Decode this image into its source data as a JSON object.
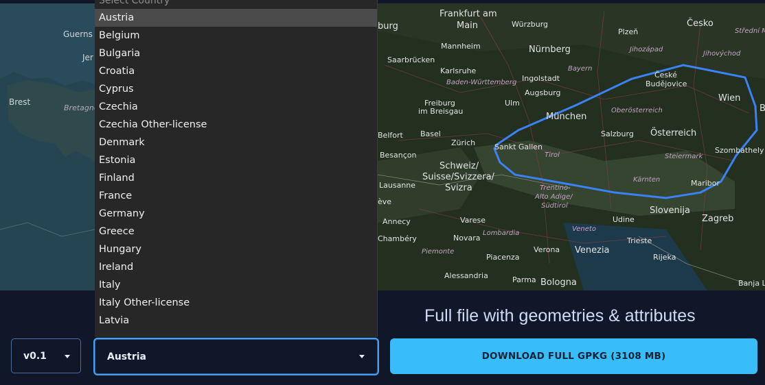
{
  "map_left": {
    "labels": [
      "Guerns",
      "Jer",
      "Brest",
      "Bretagne"
    ]
  },
  "map_right": {
    "labels": {
      "frankfurt": "Frankfurt am",
      "main": "Main",
      "wurzburg": "Würzburg",
      "plzen": "Plzeň",
      "cesko": "Česko",
      "stredni": "Střední M",
      "burg": "burg",
      "mannheim": "Mannheim",
      "nurnberg": "Nürnberg",
      "jihozapad": "Jihozápad",
      "jihovychod": "Jihovýchod",
      "saarbrucken": "Saarbrücken",
      "karlsruhe": "Karlsruhe",
      "bayern": "Bayern",
      "ceske": "České",
      "budejovice": "Budějovice",
      "bw": "Baden-Württemberg",
      "ingolstadt": "Ingolstadt",
      "augsburg": "Augsburg",
      "freiburg": "Freiburg",
      "breisgau": "im Breisgau",
      "ulm": "Ulm",
      "munchen": "München",
      "oberosterreich": "Oberösterreich",
      "wien": "Wien",
      "belfort": "Belfort",
      "basel": "Basel",
      "zurich": "Zürich",
      "salzburg": "Salzburg",
      "osterreich": "Österreich",
      "besancon": "Besançon",
      "stgallen": "Sankt Gallen",
      "tirol": "Tirol",
      "steiermark": "Steiermark",
      "szombathely": "Szombathely",
      "schweiz": "Schweiz/",
      "suisse": "Suisse/Svizzera/",
      "svizra": "Svizra",
      "lausanne": "Lausanne",
      "trentino": "Trentino-",
      "altoadige": "Alto Adige/",
      "sudtirol": "Südtirol",
      "karnten": "Kärnten",
      "maribor": "Maribor",
      "eve": "ève",
      "slovenija": "Slovenija",
      "annecy": "Annecy",
      "varese": "Varese",
      "udine": "Udine",
      "zagreb": "Zagreb",
      "chambery": "Chambéry",
      "lombardia": "Lombardia",
      "novara": "Novara",
      "veneto": "Veneto",
      "trieste": "Trieste",
      "piemonte": "Piemonte",
      "verona": "Verona",
      "venezia": "Venezia",
      "rijeka": "Rijeka",
      "piacenza": "Piacenza",
      "alessandria": "Alessandria",
      "parma": "Parma",
      "bologna": "Bologna",
      "banjal": "Banja L",
      "b": "B"
    }
  },
  "dropdown": {
    "placeholder": "Select Country",
    "options": [
      "Austria",
      "Belgium",
      "Bulgaria",
      "Croatia",
      "Cyprus",
      "Czechia",
      "Czechia Other-license",
      "Denmark",
      "Estonia",
      "Finland",
      "France",
      "Germany",
      "Greece",
      "Hungary",
      "Ireland",
      "Italy",
      "Italy Other-license",
      "Latvia"
    ],
    "selected_index": 0
  },
  "heading": "Full file with geometries & attributes",
  "version_select": {
    "value": "v0.1"
  },
  "country_select": {
    "value": "Austria"
  },
  "download_button": {
    "label": "DOWNLOAD FULL GPKG (3108 MB)"
  },
  "colors": {
    "background": "#0f1729",
    "accent": "#38bdf8",
    "boundary": "#3b82f6",
    "focus_border": "#4aa0f0"
  },
  "icons": [
    "chevron-down-icon"
  ]
}
